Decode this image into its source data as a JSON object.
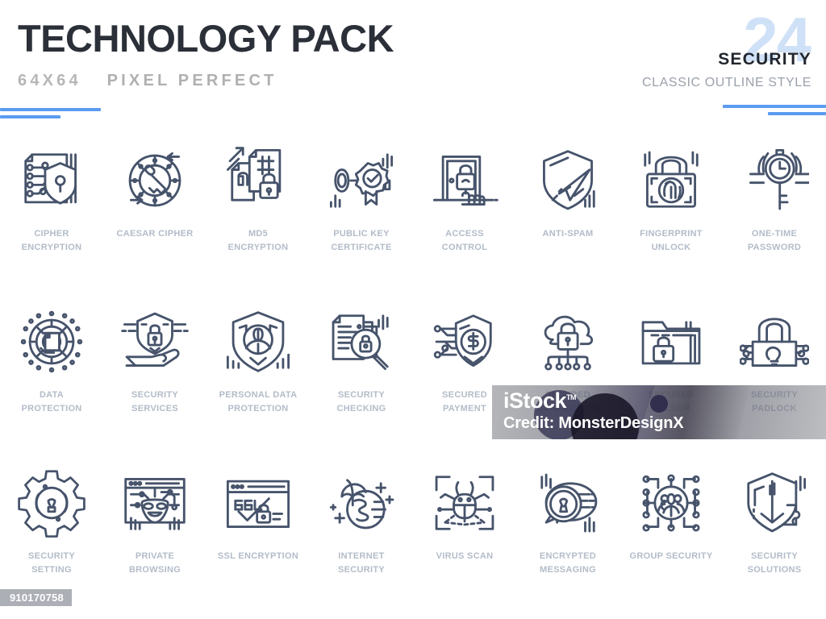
{
  "header": {
    "title": "TECHNOLOGY PACK",
    "subtitle_size": "64X64",
    "subtitle_text": "PIXEL PERFECT",
    "count": "24",
    "category": "SECURITY",
    "style": "CLASSIC OUTLINE STYLE",
    "accent_color": "#5b9bf0",
    "count_color": "#cfe1f7",
    "title_color": "#2b2f38",
    "label_color": "#b3bcc8",
    "icon_stroke_color": "#46536b"
  },
  "icons": [
    {
      "label": "CIPHER\nENCRYPTION",
      "name": "cipher-encryption",
      "glyph": "circuit-book-shield-keyhole"
    },
    {
      "label": "CAESAR CIPHER",
      "name": "caesar-cipher",
      "glyph": "cipher-wheel-key"
    },
    {
      "label": "MD5\nENCRYPTION",
      "name": "md5-encryption",
      "glyph": "documents-hash-lock-arrow"
    },
    {
      "label": "PUBLIC KEY\nCERTIFICATE",
      "name": "public-key-certificate",
      "glyph": "key-certificate-rosette-check"
    },
    {
      "label": "ACCESS CONTROL",
      "name": "access-control",
      "glyph": "door-padlock-hand-press"
    },
    {
      "label": "ANTI-SPAM",
      "name": "anti-spam",
      "glyph": "shield-paper-plane"
    },
    {
      "label": "FINGERPRINT\nUNLOCK",
      "name": "fingerprint-unlock",
      "glyph": "padlock-fingerprint-scan"
    },
    {
      "label": "ONE-TIME\nPASSWORD",
      "name": "one-time-password",
      "glyph": "key-clock-timer"
    },
    {
      "label": "DATA\nPROTECTION",
      "name": "data-protection",
      "glyph": "maze-circle-document"
    },
    {
      "label": "SECURITY\nSERVICES",
      "name": "security-services",
      "glyph": "hand-shield-padlock"
    },
    {
      "label": "PERSONAL DATA\nPROTECTION",
      "name": "personal-data-protection",
      "glyph": "shield-user-avatar"
    },
    {
      "label": "SECURITY\nCHECKING",
      "name": "security-checking",
      "glyph": "documents-magnifier-padlock"
    },
    {
      "label": "SECURED\nPAYMENT",
      "name": "secured-payment",
      "glyph": "shield-dollar-circuit"
    },
    {
      "label": "SECURED\nCONNECTION",
      "name": "secured-connection",
      "glyph": "cloud-padlock-network"
    },
    {
      "label": "SECURED\nFOLDER",
      "name": "secured-folder",
      "glyph": "folder-padlock"
    },
    {
      "label": "SECURITY\nPADLOCK",
      "name": "security-padlock",
      "glyph": "padlock-circuit-bulb"
    },
    {
      "label": "SECURITY\nSETTING",
      "name": "security-setting",
      "glyph": "gear-keyhole"
    },
    {
      "label": "PRIVATE\nBROWSING",
      "name": "private-browsing",
      "glyph": "browser-mask-circuit"
    },
    {
      "label": "SSL ENCRYPTION",
      "name": "ssl-encryption",
      "glyph": "browser-ssl-check-padlock"
    },
    {
      "label": "INTERNET\nSECURITY",
      "name": "internet-security",
      "glyph": "globe-umbrella"
    },
    {
      "label": "VIRUS SCAN",
      "name": "virus-scan",
      "glyph": "bug-scan-frame"
    },
    {
      "label": "ENCRYPTED\nMESSAGING",
      "name": "encrypted-messaging",
      "glyph": "chat-bubbles-keyhole"
    },
    {
      "label": "GROUP SECURITY",
      "name": "group-security",
      "glyph": "users-network-nodes"
    },
    {
      "label": "SECURITY\nSOLUTIONS",
      "name": "security-solutions",
      "glyph": "shield-puzzle-piece"
    }
  ],
  "watermark": {
    "brand": "iStock",
    "trademark": "TM",
    "credit": "Credit: MonsterDesignX",
    "image_id": "910170758"
  }
}
